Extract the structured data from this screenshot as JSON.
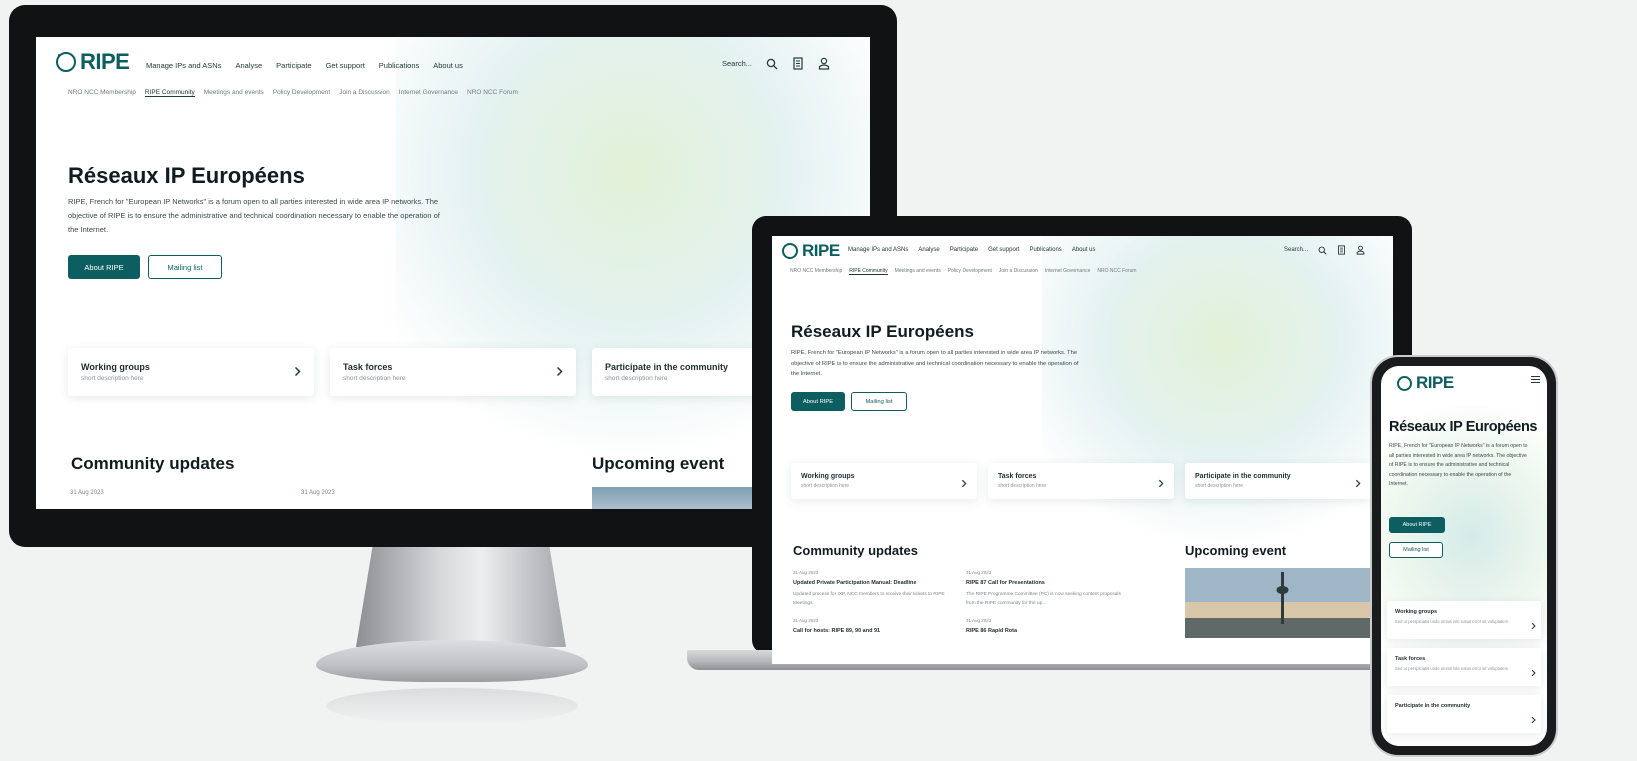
{
  "brand": {
    "name": "RIPE",
    "accent": "#0d5e60",
    "button_text_color": "#ffffff"
  },
  "nav": {
    "items": [
      "Manage IPs and ASNs",
      "Analyse",
      "Participate",
      "Get support",
      "Publications",
      "About us"
    ],
    "search_label": "Search...",
    "search_icon": "search-icon",
    "list_icon": "list-icon",
    "user_icon": "user-icon"
  },
  "subnav": {
    "items": [
      "NRO NCC Membership",
      "RIPE Community",
      "Meetings and events",
      "Policy Development",
      "Join a Discussion",
      "Internet Governance",
      "NRO NCC Forum"
    ],
    "active": "RIPE Community"
  },
  "hero": {
    "title": "Réseaux IP Européens",
    "description": "RIPE, French for \"European IP Networks\" is a forum open to all parties interested in wide area IP networks. The objective of RIPE is to ensure the administrative and technical coordination necessary to enable the operation of the Internet.",
    "primary_button": "About RIPE",
    "secondary_button": "Mailing list"
  },
  "cards": [
    {
      "title": "Working groups",
      "subtitle": "short description here"
    },
    {
      "title": "Task forces",
      "subtitle": "short description here"
    },
    {
      "title": "Participate in the community",
      "subtitle": "short description here"
    }
  ],
  "phone_cards": [
    {
      "title": "Working groups",
      "subtitle": "Sed ut perspiciatis unde omnis iste natus error sit voluptatem"
    },
    {
      "title": "Task forces",
      "subtitle": "Sed ut perspiciatis unde omnis iste natus error sit voluptatem"
    },
    {
      "title": "Participate in the community",
      "subtitle": ""
    }
  ],
  "community": {
    "title": "Community updates",
    "items": [
      {
        "date": "31 Aug 2023",
        "title": "Updated Private Participation Manual: Deadline",
        "summary": "Updated process for IXP, NCC members to receive their tickets to RIPE Meetings"
      },
      {
        "date": "31 Aug 2023",
        "title": "RIPE 87 Call for Presentations",
        "summary": "The RIPE Programme Committee (PC) is now seeking content proposals from the RIPE community for the up..."
      },
      {
        "date": "31 Aug 2023",
        "title": "Call for hosts: RIPE 89, 90 and 91",
        "summary": ""
      },
      {
        "date": "31 Aug 2023",
        "title": "RIPE 86 Rapid Rota",
        "summary": ""
      }
    ]
  },
  "event": {
    "title": "Upcoming event"
  },
  "menu_icon": "hamburger-icon",
  "chevron_icon": "chevron-right-icon"
}
